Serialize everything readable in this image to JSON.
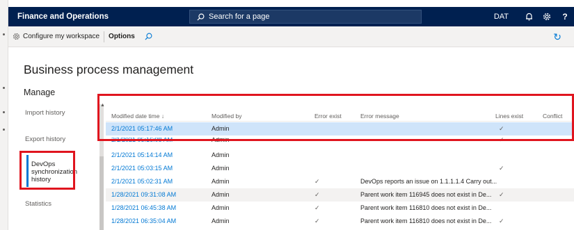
{
  "header": {
    "app_title": "Finance and Operations",
    "search_placeholder": "Search for a page",
    "company": "DAT"
  },
  "actions": {
    "configure_workspace": "Configure my workspace",
    "options": "Options"
  },
  "page": {
    "title": "Business process management",
    "section": "Manage"
  },
  "nav": {
    "items": [
      {
        "label": "Import history",
        "selected": false
      },
      {
        "label": "Export history",
        "selected": false
      },
      {
        "label": "DevOps synchronization history",
        "selected": true
      },
      {
        "label": "Statistics",
        "selected": false
      }
    ]
  },
  "grid": {
    "columns": [
      "Modified date time ↓",
      "Modified by",
      "Error exist",
      "Error message",
      "Lines exist",
      "Conflict"
    ],
    "rows": [
      {
        "date": "2/1/2021 05:17:46 AM",
        "by": "Admin",
        "error_exist": "",
        "message": "",
        "lines_exist": "✓",
        "selected": true
      },
      {
        "date": "2/1/2021 05:16:08 AM",
        "by": "Admin",
        "error_exist": "",
        "message": "",
        "lines_exist": "✓",
        "selected": false
      },
      {
        "date": "2/1/2021 05:14:14 AM",
        "by": "Admin",
        "error_exist": "",
        "message": "",
        "lines_exist": "",
        "selected": false
      },
      {
        "date": "2/1/2021 05:03:15 AM",
        "by": "Admin",
        "error_exist": "",
        "message": "",
        "lines_exist": "✓",
        "selected": false
      },
      {
        "date": "2/1/2021 05:02:31 AM",
        "by": "Admin",
        "error_exist": "✓",
        "message": "DevOps reports an issue on 1.1.1.1.4 Carry out...",
        "lines_exist": "",
        "selected": false
      },
      {
        "date": "1/28/2021 09:31:08 AM",
        "by": "Admin",
        "error_exist": "✓",
        "message": "Parent work item 116945 does not exist in De...",
        "lines_exist": "✓",
        "selected": false
      },
      {
        "date": "1/28/2021 06:45:38 AM",
        "by": "Admin",
        "error_exist": "✓",
        "message": "Parent work item 116810 does not exist in De...",
        "lines_exist": "",
        "selected": false
      },
      {
        "date": "1/28/2021 06:35:04 AM",
        "by": "Admin",
        "error_exist": "✓",
        "message": "Parent work item 116810 does not exist in De...",
        "lines_exist": "✓",
        "selected": false
      }
    ]
  },
  "colors": {
    "nav_bar": "#002050",
    "accent": "#0078d4",
    "annotation": "#e0141e",
    "selected_row": "#cfe4fa"
  },
  "icons": [
    "search-icon",
    "bell-icon",
    "gear-icon",
    "help-icon",
    "configure-gear-icon",
    "refresh-icon",
    "checkmark-icon"
  ]
}
